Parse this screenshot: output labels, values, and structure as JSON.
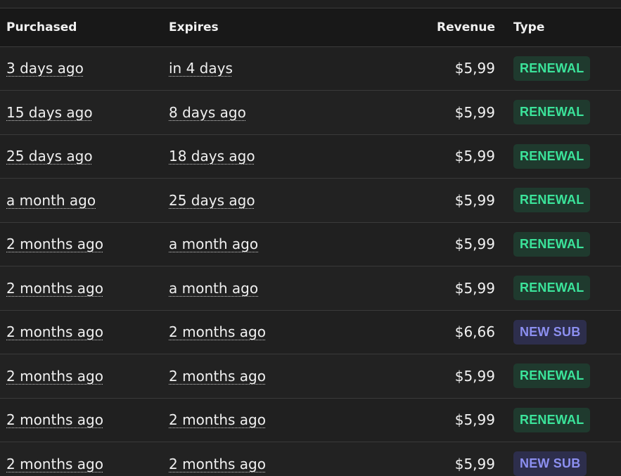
{
  "table": {
    "headers": {
      "purchased": "Purchased",
      "expires": "Expires",
      "revenue": "Revenue",
      "type": "Type"
    },
    "rows": [
      {
        "purchased": "3 days ago",
        "expires": "in 4 days",
        "revenue": "$5,99",
        "type": "RENEWAL",
        "type_kind": "renewal"
      },
      {
        "purchased": "15 days ago",
        "expires": "8 days ago",
        "revenue": "$5,99",
        "type": "RENEWAL",
        "type_kind": "renewal"
      },
      {
        "purchased": "25 days ago",
        "expires": "18 days ago",
        "revenue": "$5,99",
        "type": "RENEWAL",
        "type_kind": "renewal"
      },
      {
        "purchased": "a month ago",
        "expires": "25 days ago",
        "revenue": "$5,99",
        "type": "RENEWAL",
        "type_kind": "renewal"
      },
      {
        "purchased": "2 months ago",
        "expires": "a month ago",
        "revenue": "$5,99",
        "type": "RENEWAL",
        "type_kind": "renewal"
      },
      {
        "purchased": "2 months ago",
        "expires": "a month ago",
        "revenue": "$5,99",
        "type": "RENEWAL",
        "type_kind": "renewal"
      },
      {
        "purchased": "2 months ago",
        "expires": "2 months ago",
        "revenue": "$6,66",
        "type": "NEW SUB",
        "type_kind": "newsub"
      },
      {
        "purchased": "2 months ago",
        "expires": "2 months ago",
        "revenue": "$5,99",
        "type": "RENEWAL",
        "type_kind": "renewal"
      },
      {
        "purchased": "2 months ago",
        "expires": "2 months ago",
        "revenue": "$5,99",
        "type": "RENEWAL",
        "type_kind": "renewal"
      },
      {
        "purchased": "2 months ago",
        "expires": "2 months ago",
        "revenue": "$5,99",
        "type": "NEW SUB",
        "type_kind": "newsub"
      }
    ]
  },
  "colors": {
    "background": "#202020",
    "header_background": "#181818",
    "row_divider": "#3a3a3a",
    "renewal_bg": "#1f3a2e",
    "renewal_text": "#3be39a",
    "newsub_bg": "#2d2e4c",
    "newsub_text": "#8c8ff0"
  }
}
